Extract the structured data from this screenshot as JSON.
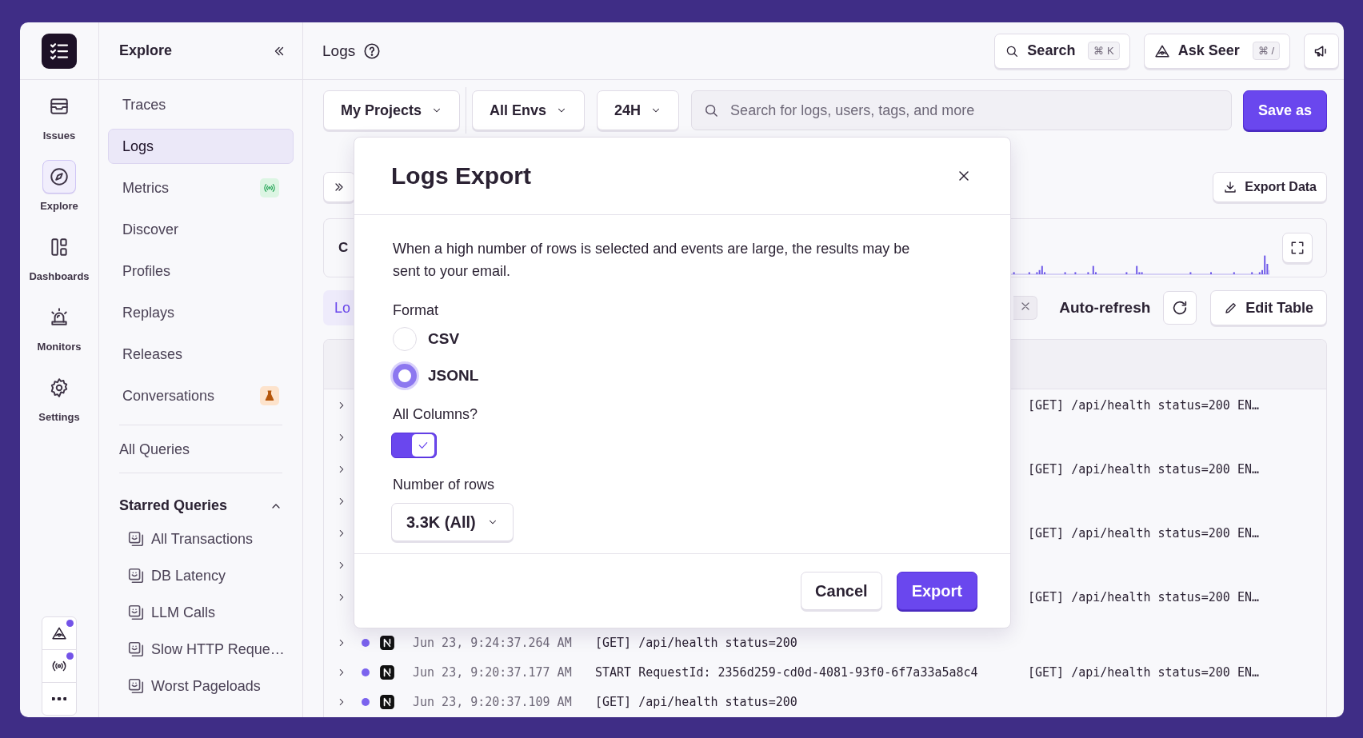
{
  "rail": {
    "items": [
      {
        "label": "Issues",
        "selected": false
      },
      {
        "label": "Explore",
        "selected": true
      },
      {
        "label": "Dashboards",
        "selected": false
      },
      {
        "label": "Monitors",
        "selected": false
      },
      {
        "label": "Settings",
        "selected": false
      }
    ],
    "footer_buttons": [
      {
        "badge": true
      },
      {
        "badge": true
      },
      {
        "badge": false
      }
    ]
  },
  "sidebar": {
    "title": "Explore",
    "items": [
      {
        "label": "Traces",
        "selected": false,
        "kind": "plain"
      },
      {
        "label": "Logs",
        "selected": true,
        "kind": "plain"
      },
      {
        "label": "Metrics",
        "selected": false,
        "kind": "live"
      },
      {
        "label": "Discover",
        "selected": false,
        "kind": "plain"
      },
      {
        "label": "Profiles",
        "selected": false,
        "kind": "plain"
      },
      {
        "label": "Replays",
        "selected": false,
        "kind": "plain"
      },
      {
        "label": "Releases",
        "selected": false,
        "kind": "plain"
      },
      {
        "label": "Conversations",
        "selected": false,
        "kind": "beta"
      }
    ],
    "all_queries": "All Queries",
    "starred": {
      "title": "Starred Queries",
      "expanded": true,
      "items": [
        "All Transactions",
        "DB Latency",
        "LLM Calls",
        "Slow HTTP Reque…",
        "Worst Pageloads"
      ]
    }
  },
  "header": {
    "title": "Logs",
    "search": {
      "label": "Search",
      "shortcut": "⌘ K"
    },
    "ask": {
      "label": "Ask Seer",
      "shortcut": "⌘ /"
    }
  },
  "filters": [
    {
      "label": "My Projects"
    },
    {
      "label": "All Envs"
    },
    {
      "label": "24H"
    }
  ],
  "search_field": {
    "placeholder": "Search for logs, users, tags, and more"
  },
  "save_button": "Save as",
  "export_button": "Export Data",
  "chart": {
    "title": "C"
  },
  "mode_tab": {
    "label": "Lo",
    "selected": true
  },
  "auto_refresh": {
    "label": "Auto-refresh",
    "on": false
  },
  "edit_table": "Edit Table",
  "rows": [
    {
      "expanded": false,
      "tail": "[GET] /api/health status=200 EN…"
    },
    {
      "expanded": false
    },
    {
      "expanded": false,
      "tail": "[GET] /api/health status=200 EN…"
    },
    {
      "expanded": false
    },
    {
      "expanded": false,
      "tail": "[GET] /api/health status=200 EN…"
    },
    {
      "expanded": false
    },
    {
      "expanded": false,
      "tail": "[GET] /api/health status=200 EN…"
    },
    {
      "expanded": false,
      "timestamp": "Jun 23, 9:24:37.264 AM",
      "message": "[GET] /api/health status=200"
    },
    {
      "expanded": false,
      "timestamp": "Jun 23, 9:20:37.177 AM",
      "message": "START RequestId: 2356d259-cd0d-4081-93f0-6f7a33a5a8c4",
      "tail": "[GET] /api/health status=200 EN…"
    },
    {
      "expanded": false,
      "timestamp": "Jun 23, 9:20:37.109 AM",
      "message": "[GET] /api/health status=200"
    }
  ],
  "modal": {
    "title": "Logs Export",
    "description": "When a high number of rows is selected and events are large, the results may be sent to your email.",
    "format": {
      "label": "Format",
      "options": [
        {
          "label": "CSV",
          "selected": false
        },
        {
          "label": "JSONL",
          "selected": true
        }
      ]
    },
    "all_columns": {
      "label": "All Columns?",
      "on": true
    },
    "rows_select": {
      "label": "Number of rows",
      "value": "3.3K (All)"
    },
    "buttons": [
      {
        "label": "Cancel",
        "kind": "secondary"
      },
      {
        "label": "Export",
        "kind": "primary"
      }
    ]
  }
}
